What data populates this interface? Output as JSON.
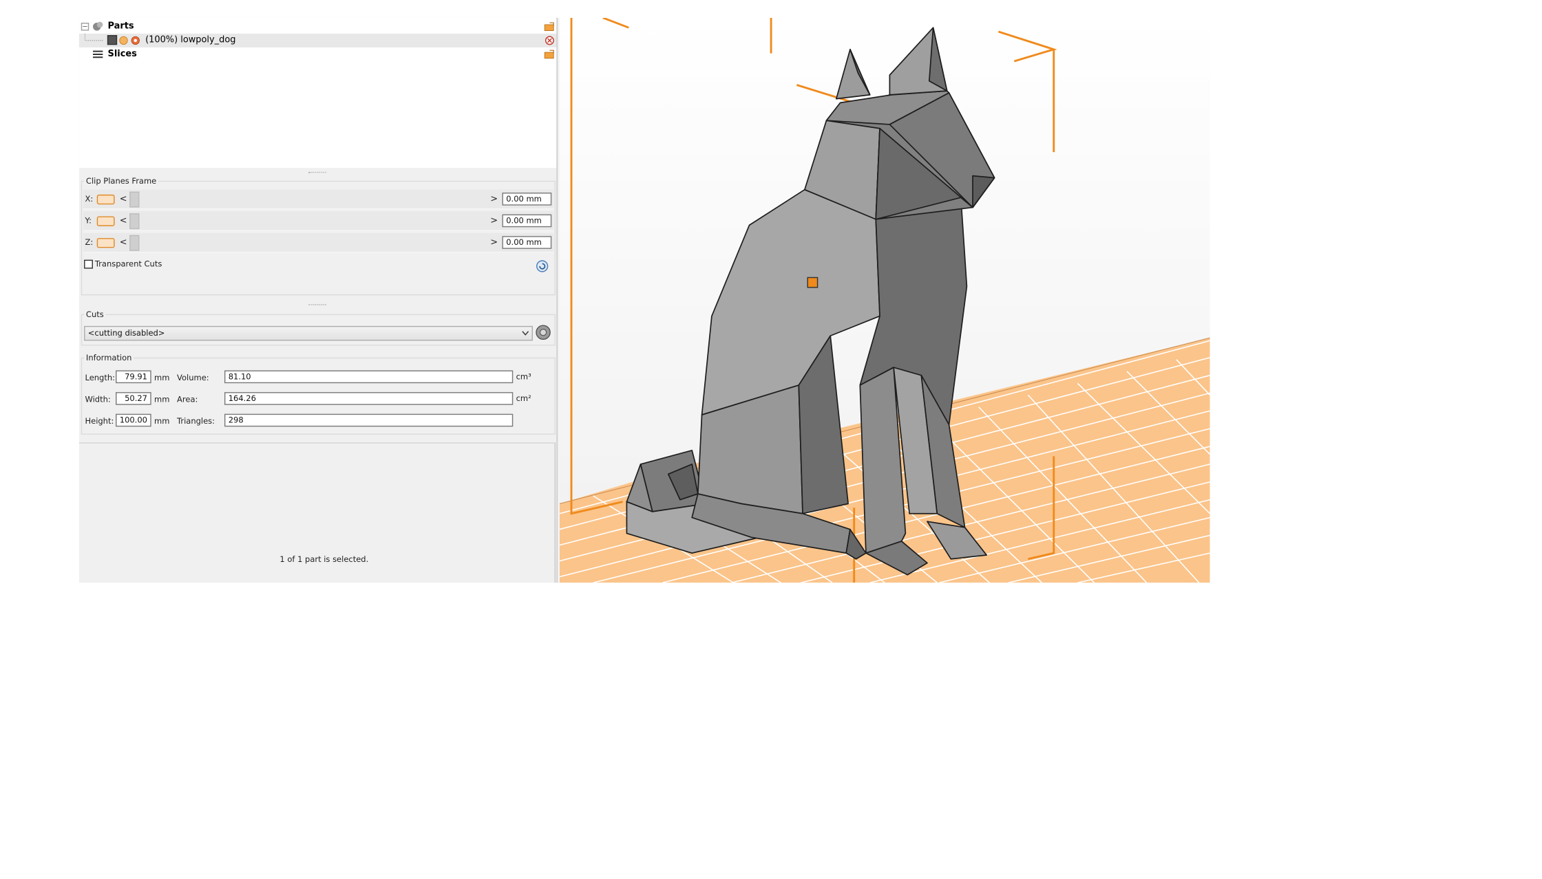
{
  "tree": {
    "parts_label": "Parts",
    "part_item": "(100%) lowpoly_dog",
    "slices_label": "Slices"
  },
  "clip_planes": {
    "title": "Clip Planes Frame",
    "x_label": "X:",
    "y_label": "Y:",
    "z_label": "Z:",
    "left_arrow": "<",
    "right_arrow": ">",
    "x_value": "0.00 mm",
    "y_value": "0.00 mm",
    "z_value": "0.00 mm",
    "transparent_cuts": "Transparent Cuts"
  },
  "cuts": {
    "title": "Cuts",
    "selected": "<cutting disabled>"
  },
  "information": {
    "title": "Information",
    "length_label": "Length:",
    "length_value": "79.91",
    "width_label": "Width:",
    "width_value": "50.27",
    "height_label": "Height:",
    "height_value": "100.00",
    "unit_mm": "mm",
    "volume_label": "Volume:",
    "volume_value": "81.10",
    "area_label": "Area:",
    "area_value": "164.26",
    "triangles_label": "Triangles:",
    "triangles_value": "298",
    "unit_cm3": "cm³",
    "unit_cm2": "cm²"
  },
  "status": {
    "selection_text": "1 of 1 part is selected."
  },
  "icons": {
    "accent": "#f08a1c",
    "dog_light": "#a0a0a0",
    "dog_dark": "#6e6e6e",
    "platform": "#fbc48a"
  }
}
